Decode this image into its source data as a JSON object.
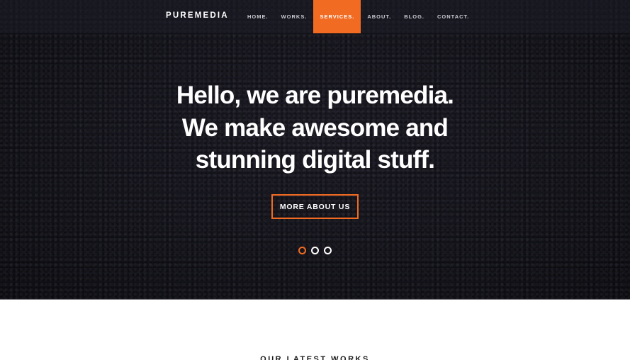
{
  "navbar": {
    "brand": "PUREMEDIA",
    "items": [
      {
        "label": "HOME.",
        "active": false
      },
      {
        "label": "WORKS.",
        "active": false
      },
      {
        "label": "SERVICES.",
        "active": true
      },
      {
        "label": "ABOUT.",
        "active": false
      },
      {
        "label": "BLOG.",
        "active": false
      },
      {
        "label": "CONTACT.",
        "active": false
      }
    ]
  },
  "hero": {
    "headline_lines": [
      "Hello, we are puremedia.",
      "We make awesome and",
      "stunning digital stuff."
    ],
    "cta_label": "MORE ABOUT US",
    "slider": {
      "total": 3,
      "active_index": 0
    }
  },
  "latest_works": {
    "title": "OUR LATEST WORKS"
  },
  "colors": {
    "accent": "#f26b22",
    "hero_bg": "#14141c",
    "text_light": "#ffffff"
  }
}
